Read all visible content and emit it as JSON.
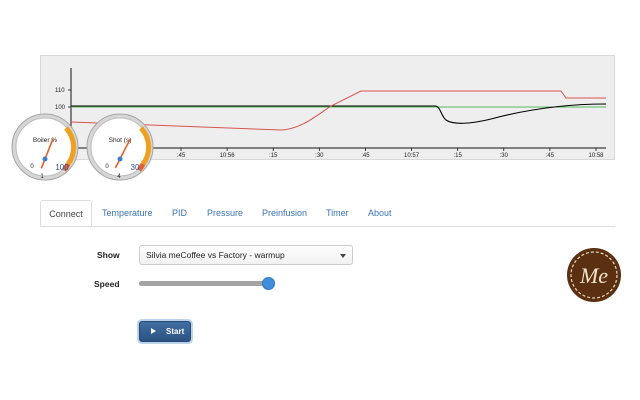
{
  "chart": {
    "y_ticks": [
      "110",
      "100"
    ],
    "x_ticks": [
      ":45",
      "10:56",
      ":15",
      ":30",
      ":45",
      "10:57",
      ":15",
      ":30",
      ":45",
      "10:58"
    ],
    "colors": {
      "temperature": "#d9534f",
      "target": "#000000",
      "reference": "#5cb85c",
      "axis": "#111111"
    }
  },
  "gauges": [
    {
      "title": "Boiler %",
      "min_label": "0",
      "max_label": "100",
      "low_label": "1",
      "value_fraction": 0.58
    },
    {
      "title": "Shot (s)",
      "min_label": "0",
      "max_label": "30",
      "low_label": "4",
      "value_fraction": 0.6
    }
  ],
  "tabs": [
    {
      "label": "Connect",
      "active": true
    },
    {
      "label": "Temperature",
      "active": false
    },
    {
      "label": "PID",
      "active": false
    },
    {
      "label": "Pressure",
      "active": false
    },
    {
      "label": "Preinfusion",
      "active": false
    },
    {
      "label": "Timer",
      "active": false
    },
    {
      "label": "About",
      "active": false
    }
  ],
  "form": {
    "show_label": "Show",
    "show_value": "Silvia meCoffee vs Factory - warmup",
    "speed_label": "Speed",
    "speed_fraction": 0.98,
    "start_label": "Start"
  },
  "logo": {
    "icon": "mecoffee-logo-icon",
    "text": "Me"
  },
  "colors": {
    "accent": "#3a73b7",
    "button": "#336299",
    "slider_thumb": "#3e8edc"
  }
}
